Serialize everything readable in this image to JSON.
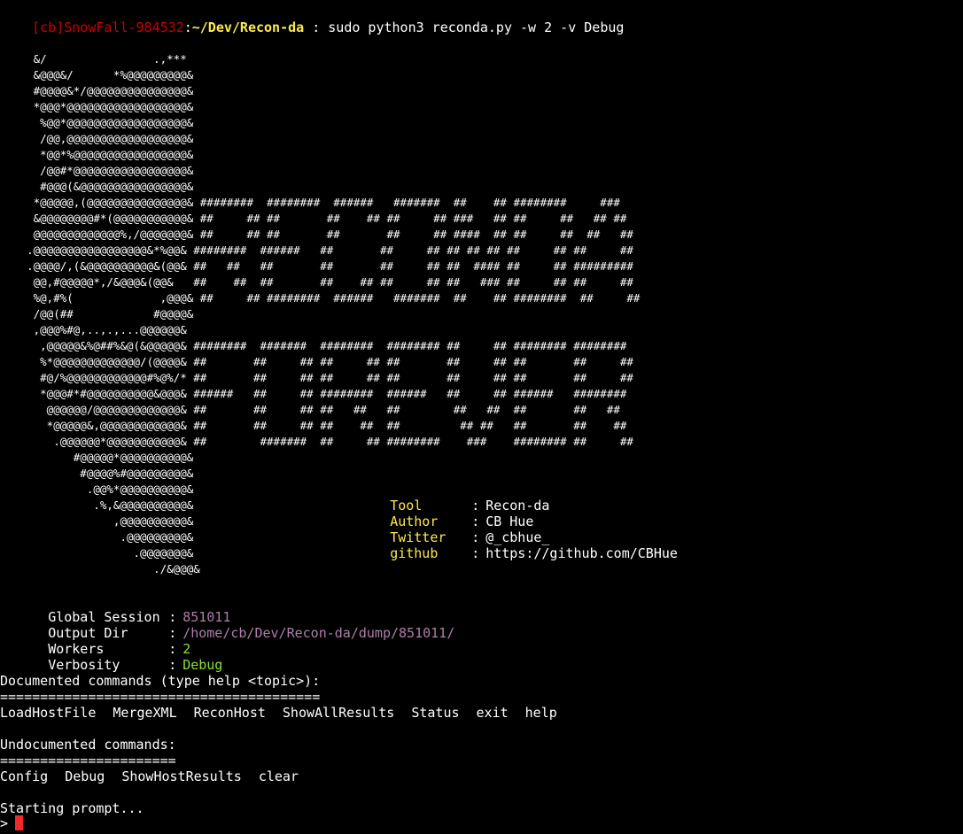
{
  "prompt": {
    "bracket_open": "[",
    "user": "cb",
    "bracket_close": "]",
    "host": "SnowFall-984532",
    "colon": ":",
    "path": "~/Dev/Recon-da",
    "command": " : sudo python3 reconda.py -w 2 -v Debug"
  },
  "banner_art": "     &/                .,***\n     &@@@&/      *%@@@@@@@@@&\n     #@@@@&*/@@@@@@@@@@@@@@@&\n     *@@@*@@@@@@@@@@@@@@@@@@&\n      %@@*@@@@@@@@@@@@@@@@@@&\n      /@@,@@@@@@@@@@@@@@@@@@&\n      *@@*%@@@@@@@@@@@@@@@@@&\n      /@@#*@@@@@@@@@@@@@@@@@&\n      #@@@(&@@@@@@@@@@@@@@@@&\n     *@@@@@,(@@@@@@@@@@@@@@@& ########  ########  ######   #######  ##    ## ########     ###\n     &@@@@@@@@#*(@@@@@@@@@@@& ##     ## ##       ##    ## ##     ## ###   ## ##     ##   ## ##\n     @@@@@@@@@@@@@%,/@@@@@@@& ##     ## ##       ##       ##     ## ####  ## ##     ##  ##   ##\n    .@@@@@@@@@@@@@@@@@&*%@@& ########  ######   ##       ##     ## ## ## ## ##     ## ##     ##\n    .@@@@/,(&@@@@@@@@@@&(@@& ##   ##   ##       ##       ##     ## ##  #### ##     ## #########\n     @@,#@@@@@*,/&@@@&(@@&   ##    ##  ##       ##    ## ##     ## ##   ### ##     ## ##     ##\n     %@,#%(             ,@@@& ##     ## ########  ######   #######  ##    ## ########  ##     ##\n     /@@(##            #@@@@&\n     ,@@@%#@,..,.,...@@@@@@&\n      ,@@@@@&%@##%&@(&@@@@@& ########  #######  ########  ######## ##     ## ######## ########\n      %*@@@@@@@@@@@@@/(@@@@& ##       ##     ## ##     ## ##       ##     ## ##       ##     ##\n      #@/%@@@@@@@@@@@@#%@%/* ##       ##     ## ##     ## ##       ##     ## ##       ##     ##\n      *@@@#*#@@@@@@@@@@&@@@& ######   ##     ## ########  ######   ##     ## ######   ########\n       @@@@@@/@@@@@@@@@@@@@& ##       ##     ## ##   ##   ##        ##   ##  ##       ##   ##\n       *@@@@@&,@@@@@@@@@@@@& ##       ##     ## ##    ##  ##         ## ##   ##       ##    ##\n        .@@@@@@*@@@@@@@@@@@& ##        #######  ##     ## ########    ###    ######## ##     ##\n           #@@@@@*@@@@@@@@@@&\n            #@@@@%#@@@@@@@@@&\n             .@@%*@@@@@@@@@@&\n              .%,&@@@@@@@@@@&\n                 ,@@@@@@@@@@&\n                  .@@@@@@@@@&\n                    .@@@@@@@&\n                       ./&@@@&",
  "info": [
    {
      "key": "Tool",
      "sep": ":",
      "value": "Recon-da"
    },
    {
      "key": "Author",
      "sep": ":",
      "value": "CB Hue"
    },
    {
      "key": "Twitter",
      "sep": ":",
      "value": "@_cbhue_"
    },
    {
      "key": "github",
      "sep": ":",
      "value": "https://github.com/CBHue"
    }
  ],
  "status": [
    {
      "key": "Global Session",
      "sep": ":",
      "value": "851011",
      "color": "#ad7fa8"
    },
    {
      "key": "Output Dir",
      "sep": ":",
      "value": "/home/cb/Dev/Recon-da/dump/851011/",
      "color": "#ad7fa8"
    },
    {
      "key": "Workers",
      "sep": ":",
      "value": "2",
      "color": "#8ae234"
    },
    {
      "key": "Verbosity",
      "sep": ":",
      "value": "Debug",
      "color": "#8ae234"
    }
  ],
  "documented": {
    "header": "Documented commands (type help <topic>):",
    "rule": "========================================",
    "commands": [
      "LoadHostFile",
      "MergeXML",
      "ReconHost",
      "ShowAllResults",
      "Status",
      "exit",
      "help"
    ]
  },
  "undocumented": {
    "header": "Undocumented commands:",
    "rule": "======================",
    "commands": [
      "Config",
      "Debug",
      "ShowHostResults",
      "clear"
    ]
  },
  "starting_text": "Starting prompt...",
  "input_prompt": ">",
  "colors": {
    "background": "#000000",
    "prompt_red": "#cc0000",
    "path_yellow": "#fce94f",
    "info_key_yellow": "#fce94f",
    "value_purple": "#ad7fa8",
    "value_green": "#8ae234",
    "cursor": "#ef2929"
  }
}
